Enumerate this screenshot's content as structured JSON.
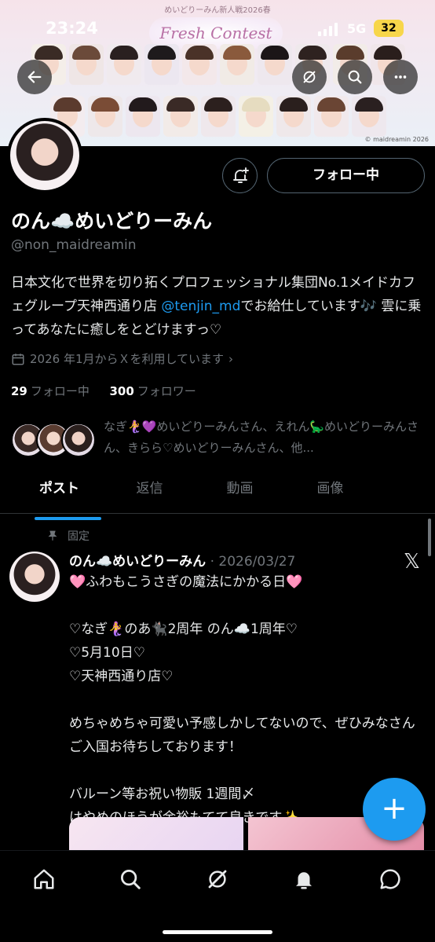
{
  "status_bar": {
    "time": "23:24",
    "network": "5G",
    "battery": "32"
  },
  "banner": {
    "title": "めいどりーみん新人戦2026春",
    "logo_text": "Fresh Contest",
    "credit": "© maidreamin 2026"
  },
  "profile": {
    "follow_button_label": "フォロー中",
    "name": "のん☁️めいどりーみん",
    "handle": "@non_maidreamin",
    "bio_part1": "日本文化で世界を切り拓くプロフェッショナル集団No.1メイドカフェグループ",
    "bio_part2": "天神西通り店",
    "bio_link": "@tenjin_md",
    "bio_part3": "でお給仕しています🎶 雲に乗ってあなたに癒しをとどけますっ♡",
    "joined": "2026 年1月からＸを利用しています",
    "following_count": "29",
    "following_label": "フォロー中",
    "followers_count": "300",
    "followers_label": "フォロワー",
    "known_followers": "なぎ🧜‍♀️💜めいどりーみんさん、えれん🦕めいどりーみんさん、きらら♡めいどりーみんさん、他..."
  },
  "tabs": [
    {
      "label": "ポスト",
      "active": true
    },
    {
      "label": "返信",
      "active": false
    },
    {
      "label": "動画",
      "active": false
    },
    {
      "label": "画像",
      "active": false
    }
  ],
  "post": {
    "pinned_label": "固定",
    "author_name": "のん☁️めいどりーみん",
    "date": "· 2026/03/27",
    "lines": [
      "🩷ふわもこうさぎの魔法にかかる日🩷",
      "",
      "♡なぎ🧜‍♀️のあ🐈‍⬛2周年 のん☁️1周年♡",
      "♡5月10日♡",
      "♡天神西通り店♡",
      "",
      "めちゃめちゃ可愛い予感しかしてないので、ぜひみなさんご入国お待ちしております！",
      "",
      "バルーン等お祝い物販 1週間〆",
      "はやめのほうが余裕もてて良きです✨"
    ]
  },
  "fab_label": "+",
  "colors": {
    "accent": "#1d9bf0",
    "background": "#000000",
    "muted": "#71767b"
  }
}
